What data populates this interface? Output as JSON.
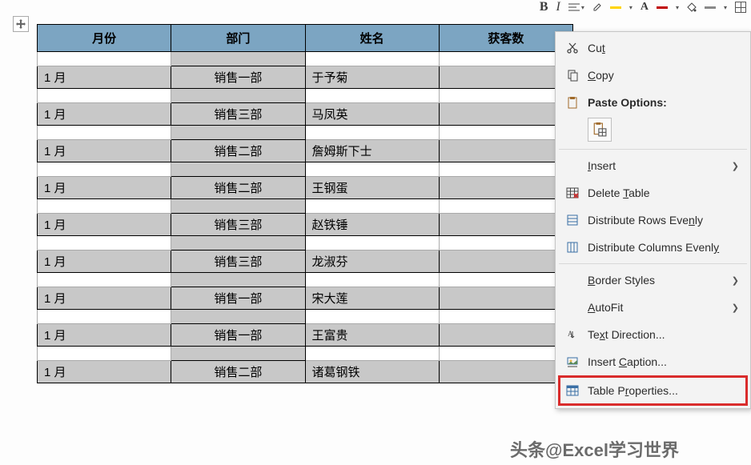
{
  "toolbar": {
    "bold": "B",
    "italic": "I",
    "fontcolor_letter": "A"
  },
  "table": {
    "headers": [
      "月份",
      "部门",
      "姓名",
      "获客数"
    ],
    "rows": [
      {
        "month": "1 月",
        "dept": "销售一部",
        "name": "于予菊",
        "count": ""
      },
      {
        "month": "1 月",
        "dept": "销售三部",
        "name": "马凤英",
        "count": ""
      },
      {
        "month": "1 月",
        "dept": "销售二部",
        "name": "詹姆斯下士",
        "count": ""
      },
      {
        "month": "1 月",
        "dept": "销售二部",
        "name": "王钢蛋",
        "count": ""
      },
      {
        "month": "1 月",
        "dept": "销售三部",
        "name": "赵铁锤",
        "count": ""
      },
      {
        "month": "1 月",
        "dept": "销售三部",
        "name": "龙淑芬",
        "count": ""
      },
      {
        "month": "1 月",
        "dept": "销售一部",
        "name": "宋大莲",
        "count": ""
      },
      {
        "month": "1 月",
        "dept": "销售一部",
        "name": "王富贵",
        "count": ""
      },
      {
        "month": "1 月",
        "dept": "销售二部",
        "name": "诸葛钢铁",
        "count": ""
      }
    ]
  },
  "context_menu": {
    "cut": "Cut",
    "copy": "Copy",
    "paste_options": "Paste Options:",
    "insert": "Insert",
    "delete_table": "Delete Table",
    "distribute_rows": "Distribute Rows Evenly",
    "distribute_cols": "Distribute Columns Evenly",
    "border_styles": "Border Styles",
    "autofit": "AutoFit",
    "text_direction": "Text Direction...",
    "insert_caption": "Insert Caption...",
    "table_properties": "Table Properties..."
  },
  "watermark": "头条@Excel学习世界"
}
